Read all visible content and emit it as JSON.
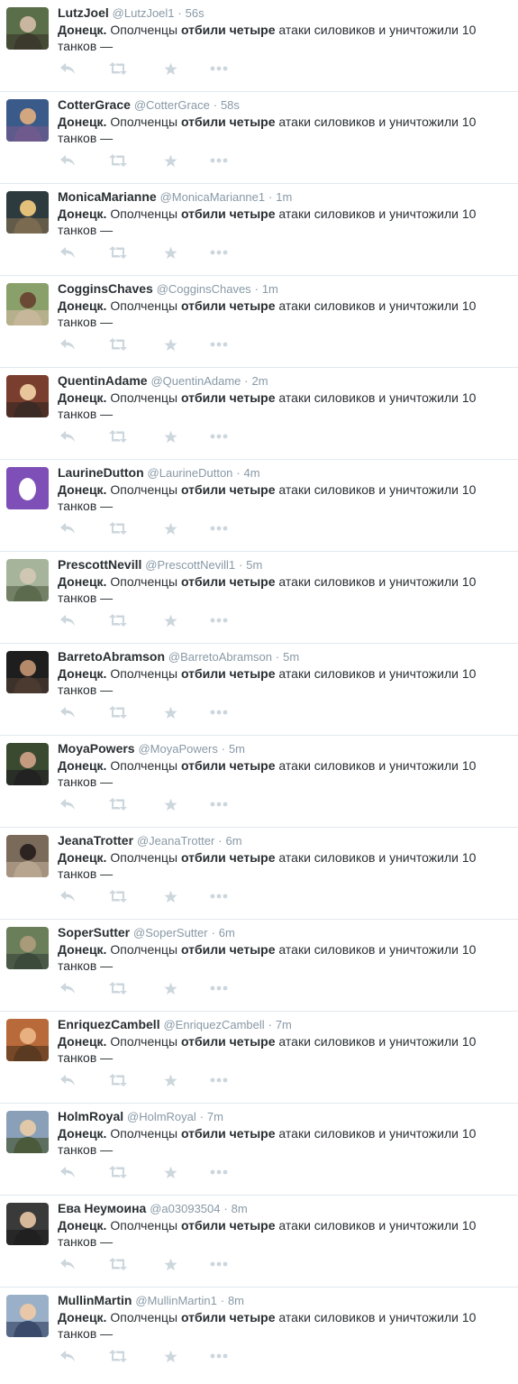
{
  "colors": {
    "text": "#292f33",
    "meta": "#8899a6",
    "icon": "#ccd6dd",
    "divider": "#e1e8ed",
    "egg_bg": "#7e4fb6"
  },
  "icons": {
    "reply": "reply-icon",
    "retweet": "retweet-icon",
    "favorite": "star-icon",
    "more": "more-icon"
  },
  "tweets": [
    {
      "name": "LutzJoel",
      "handle": "@LutzJoel1",
      "sep": "·",
      "time": "56s",
      "loc": "Донецк.",
      "t1": " Ополченцы ",
      "bold": "отбили четыре",
      "t2": " атаки силовиков и уничтожили 10 танков —",
      "avatar": "photo"
    },
    {
      "name": "CotterGrace",
      "handle": "@CotterGrace",
      "sep": "·",
      "time": "58s",
      "loc": "Донецк.",
      "t1": " Ополченцы ",
      "bold": "отбили четыре",
      "t2": " атаки силовиков и уничтожили 10 танков —",
      "avatar": "photo"
    },
    {
      "name": "MonicaMarianne",
      "handle": "@MonicaMarianne1",
      "sep": "·",
      "time": "1m",
      "loc": "Донецк.",
      "t1": " Ополченцы ",
      "bold": "отбили четыре",
      "t2": " атаки силовиков и уничтожили 10 танков —",
      "avatar": "photo"
    },
    {
      "name": "CogginsChaves",
      "handle": "@CogginsChaves",
      "sep": "·",
      "time": "1m",
      "loc": "Донецк.",
      "t1": " Ополченцы ",
      "bold": "отбили четыре",
      "t2": " атаки силовиков и уничтожили 10 танков —",
      "avatar": "photo"
    },
    {
      "name": "QuentinAdame",
      "handle": "@QuentinAdame",
      "sep": "·",
      "time": "2m",
      "loc": "Донецк.",
      "t1": " Ополченцы ",
      "bold": "отбили четыре",
      "t2": " атаки силовиков и уничтожили 10 танков —",
      "avatar": "photo"
    },
    {
      "name": "LaurineDutton",
      "handle": "@LaurineDutton",
      "sep": "·",
      "time": "4m",
      "loc": "Донецк.",
      "t1": " Ополченцы ",
      "bold": "отбили четыре",
      "t2": " атаки силовиков и уничтожили 10 танков —",
      "avatar": "egg"
    },
    {
      "name": "PrescottNevill",
      "handle": "@PrescottNevill1",
      "sep": "·",
      "time": "5m",
      "loc": "Донецк.",
      "t1": " Ополченцы ",
      "bold": "отбили четыре",
      "t2": " атаки силовиков и уничтожили 10 танков —",
      "avatar": "photo"
    },
    {
      "name": "BarretoAbramson",
      "handle": "@BarretoAbramson",
      "sep": "·",
      "time": "5m",
      "loc": "Донецк.",
      "t1": " Ополченцы ",
      "bold": "отбили четыре",
      "t2": " атаки силовиков и уничтожили 10 танков —",
      "avatar": "photo"
    },
    {
      "name": "MoyaPowers",
      "handle": "@MoyaPowers",
      "sep": "·",
      "time": "5m",
      "loc": "Донецк.",
      "t1": " Ополченцы ",
      "bold": "отбили четыре",
      "t2": " атаки силовиков и уничтожили 10 танков —",
      "avatar": "photo"
    },
    {
      "name": "JeanaTrotter",
      "handle": "@JeanaTrotter",
      "sep": "·",
      "time": "6m",
      "loc": "Донецк.",
      "t1": " Ополченцы ",
      "bold": "отбили четыре",
      "t2": " атаки силовиков и уничтожили 10 танков —",
      "avatar": "photo"
    },
    {
      "name": "SoperSutter",
      "handle": "@SoperSutter",
      "sep": "·",
      "time": "6m",
      "loc": "Донецк.",
      "t1": " Ополченцы ",
      "bold": "отбили четыре",
      "t2": " атаки силовиков и уничтожили 10 танков —",
      "avatar": "photo"
    },
    {
      "name": "EnriquezCambell",
      "handle": "@EnriquezCambell",
      "sep": "·",
      "time": "7m",
      "loc": "Донецк.",
      "t1": " Ополченцы ",
      "bold": "отбили четыре",
      "t2": " атаки силовиков и уничтожили 10 танков —",
      "avatar": "photo"
    },
    {
      "name": "HolmRoyal",
      "handle": "@HolmRoyal",
      "sep": "·",
      "time": "7m",
      "loc": "Донецк.",
      "t1": " Ополченцы ",
      "bold": "отбили четыре",
      "t2": " атаки силовиков и уничтожили 10 танков —",
      "avatar": "photo"
    },
    {
      "name": "Ева Неумоина",
      "handle": "@a03093504",
      "sep": "·",
      "time": "8m",
      "loc": "Донецк.",
      "t1": " Ополченцы ",
      "bold": "отбили четыре",
      "t2": " атаки силовиков и уничтожили 10 танков —",
      "avatar": "photo"
    },
    {
      "name": "MullinMartin",
      "handle": "@MullinMartin1",
      "sep": "·",
      "time": "8m",
      "loc": "Донецк.",
      "t1": " Ополченцы ",
      "bold": "отбили четыре",
      "t2": " атаки силовиков и уничтожили 10 танков —",
      "avatar": "photo"
    }
  ]
}
